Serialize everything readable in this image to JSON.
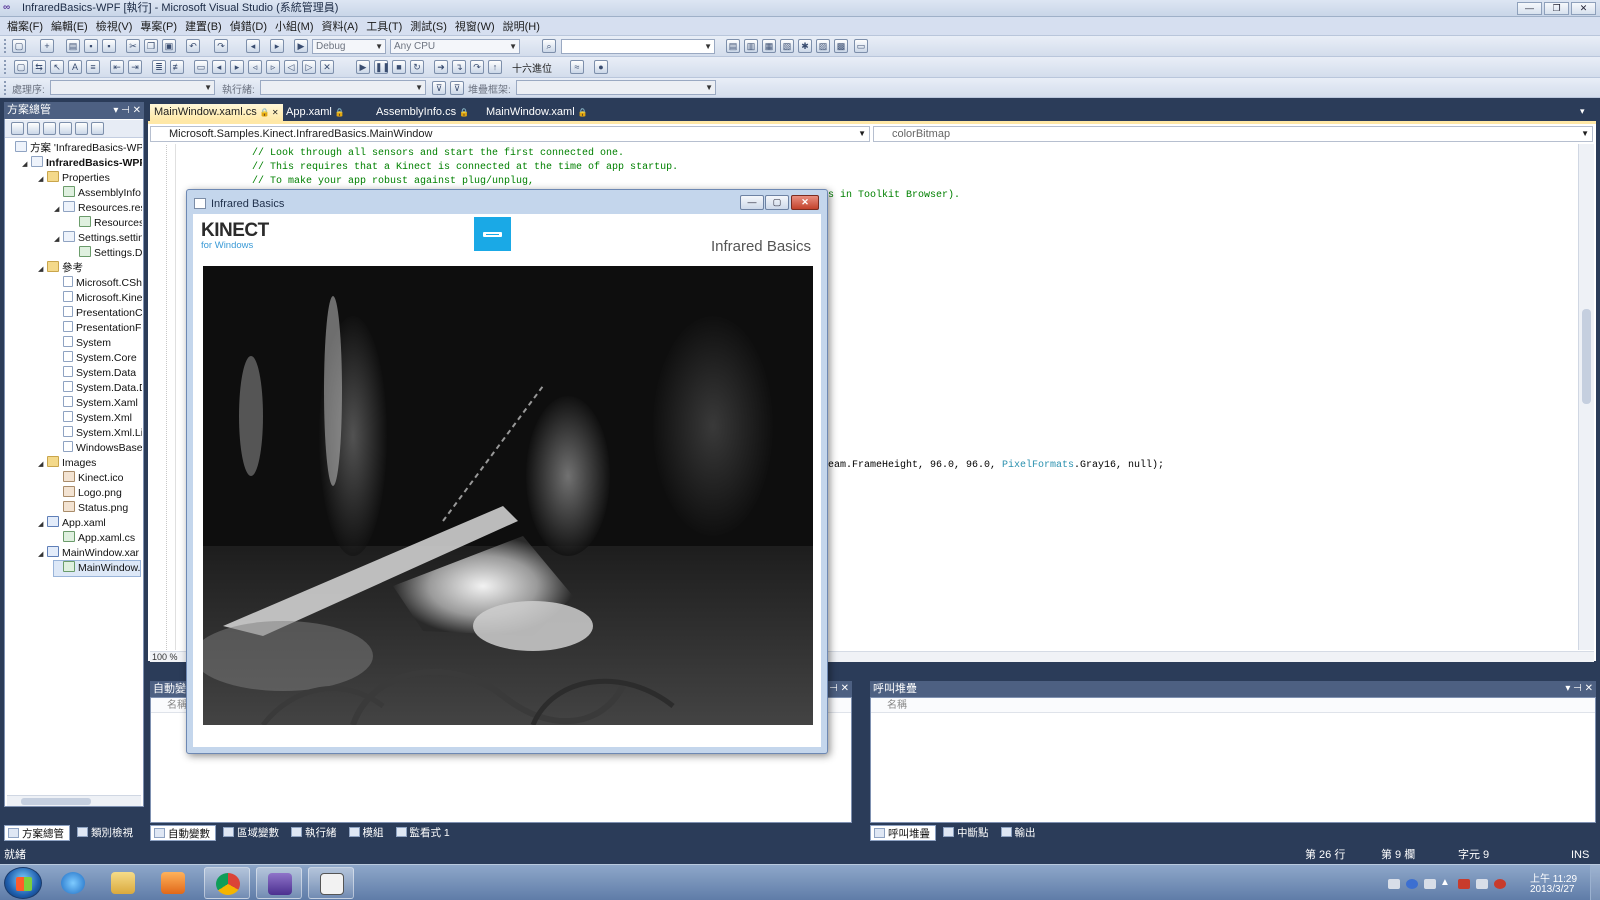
{
  "window": {
    "title": "InfraredBasics-WPF [執行] - Microsoft Visual Studio (系統管理員)",
    "controls": [
      "—",
      "❐",
      "✕"
    ]
  },
  "menu": [
    "檔案(F)",
    "編輯(E)",
    "檢視(V)",
    "專案(P)",
    "建置(B)",
    "偵錯(D)",
    "小組(M)",
    "資料(A)",
    "工具(T)",
    "測試(S)",
    "視窗(W)",
    "說明(H)"
  ],
  "toolbar": {
    "config": "Debug",
    "platform": "Any CPU",
    "hex_label": "十六進位",
    "process_label": "處理序:",
    "thread_label": "執行緒:",
    "stackframe_label": "堆疊框架:"
  },
  "solution_explorer": {
    "title": "方案總管",
    "items": [
      {
        "label": "方案 'InfraredBasics-WPF",
        "indent": 0,
        "icon": "solution",
        "exp": ""
      },
      {
        "label": "InfraredBasics-WPF",
        "indent": 1,
        "icon": "project",
        "exp": "◢",
        "bold": true
      },
      {
        "label": "Properties",
        "indent": 2,
        "icon": "folder",
        "exp": "◢"
      },
      {
        "label": "AssemblyInfo.",
        "indent": 3,
        "icon": "cs",
        "exp": ""
      },
      {
        "label": "Resources.res",
        "indent": 3,
        "icon": "resx",
        "exp": "◢"
      },
      {
        "label": "Resources.",
        "indent": 4,
        "icon": "cs",
        "exp": ""
      },
      {
        "label": "Settings.settin",
        "indent": 3,
        "icon": "settings",
        "exp": "◢"
      },
      {
        "label": "Settings.De",
        "indent": 4,
        "icon": "cs",
        "exp": ""
      },
      {
        "label": "參考",
        "indent": 2,
        "icon": "folder",
        "exp": "◢"
      },
      {
        "label": "Microsoft.CSh",
        "indent": 3,
        "icon": "ref",
        "exp": ""
      },
      {
        "label": "Microsoft.Kine",
        "indent": 3,
        "icon": "ref",
        "exp": ""
      },
      {
        "label": "PresentationC",
        "indent": 3,
        "icon": "ref",
        "exp": ""
      },
      {
        "label": "PresentationF",
        "indent": 3,
        "icon": "ref",
        "exp": ""
      },
      {
        "label": "System",
        "indent": 3,
        "icon": "ref",
        "exp": ""
      },
      {
        "label": "System.Core",
        "indent": 3,
        "icon": "ref",
        "exp": ""
      },
      {
        "label": "System.Data",
        "indent": 3,
        "icon": "ref",
        "exp": ""
      },
      {
        "label": "System.Data.D",
        "indent": 3,
        "icon": "ref",
        "exp": ""
      },
      {
        "label": "System.Xaml",
        "indent": 3,
        "icon": "ref",
        "exp": ""
      },
      {
        "label": "System.Xml",
        "indent": 3,
        "icon": "ref",
        "exp": ""
      },
      {
        "label": "System.Xml.Li",
        "indent": 3,
        "icon": "ref",
        "exp": ""
      },
      {
        "label": "WindowsBase",
        "indent": 3,
        "icon": "ref",
        "exp": ""
      },
      {
        "label": "Images",
        "indent": 2,
        "icon": "folder",
        "exp": "◢"
      },
      {
        "label": "Kinect.ico",
        "indent": 3,
        "icon": "img",
        "exp": ""
      },
      {
        "label": "Logo.png",
        "indent": 3,
        "icon": "img",
        "exp": ""
      },
      {
        "label": "Status.png",
        "indent": 3,
        "icon": "img",
        "exp": ""
      },
      {
        "label": "App.xaml",
        "indent": 2,
        "icon": "xaml",
        "exp": "◢"
      },
      {
        "label": "App.xaml.cs",
        "indent": 3,
        "icon": "cs",
        "exp": ""
      },
      {
        "label": "MainWindow.xar",
        "indent": 2,
        "icon": "xaml",
        "exp": "◢"
      },
      {
        "label": "MainWindow.",
        "indent": 3,
        "icon": "cs",
        "exp": "",
        "selected": true
      }
    ],
    "bottom_tabs": [
      "方案總管",
      "類別檢視"
    ]
  },
  "editor": {
    "tabs": [
      {
        "label": "MainWindow.xaml.cs",
        "active": true
      },
      {
        "label": "App.xaml",
        "active": false
      },
      {
        "label": "AssemblyInfo.cs",
        "active": false
      },
      {
        "label": "MainWindow.xaml",
        "active": false
      }
    ],
    "nav_left": "Microsoft.Samples.Kinect.InfraredBasics.MainWindow",
    "nav_right": "colorBitmap",
    "code_lines": [
      "// Look through all sensors and start the first connected one.",
      "// This requires that a Kinect is connected at the time of app startup.",
      "// To make your app robust against plug/unplug,"
    ],
    "code_right_1": "s in Toolkit Browser).",
    "code_right_2_pre": "eam.FrameHeight, 96.0, 96.0, ",
    "code_right_2_type": "PixelFormats",
    "code_right_2_post": ".Gray16, null);",
    "zoom": "100 %"
  },
  "bottom_left_pane": {
    "title": "自動變數",
    "column": "名稱",
    "tabs": [
      "自動變數",
      "區域變數",
      "執行緒",
      "模組",
      "監看式 1"
    ]
  },
  "bottom_right_pane": {
    "title": "呼叫堆疊",
    "column": "名稱",
    "tabs": [
      "呼叫堆疊",
      "中斷點",
      "輸出"
    ]
  },
  "statusbar": {
    "left": "就緒",
    "line": "第 26 行",
    "col": "第 9 欄",
    "char": "字元 9",
    "mode": "INS"
  },
  "app_window": {
    "title": "Infrared Basics",
    "brand": "KINECT",
    "brand_sub": "for Windows",
    "heading": "Infrared Basics"
  },
  "taskbar": {
    "time": "上午 11:29",
    "date": "2013/3/27"
  },
  "colors": {
    "vs_blue": "#2b3c59",
    "active_tab": "#ffe8a6",
    "kinect_blue": "#1aa9e6",
    "comment": "#008000",
    "type": "#2b91af"
  }
}
